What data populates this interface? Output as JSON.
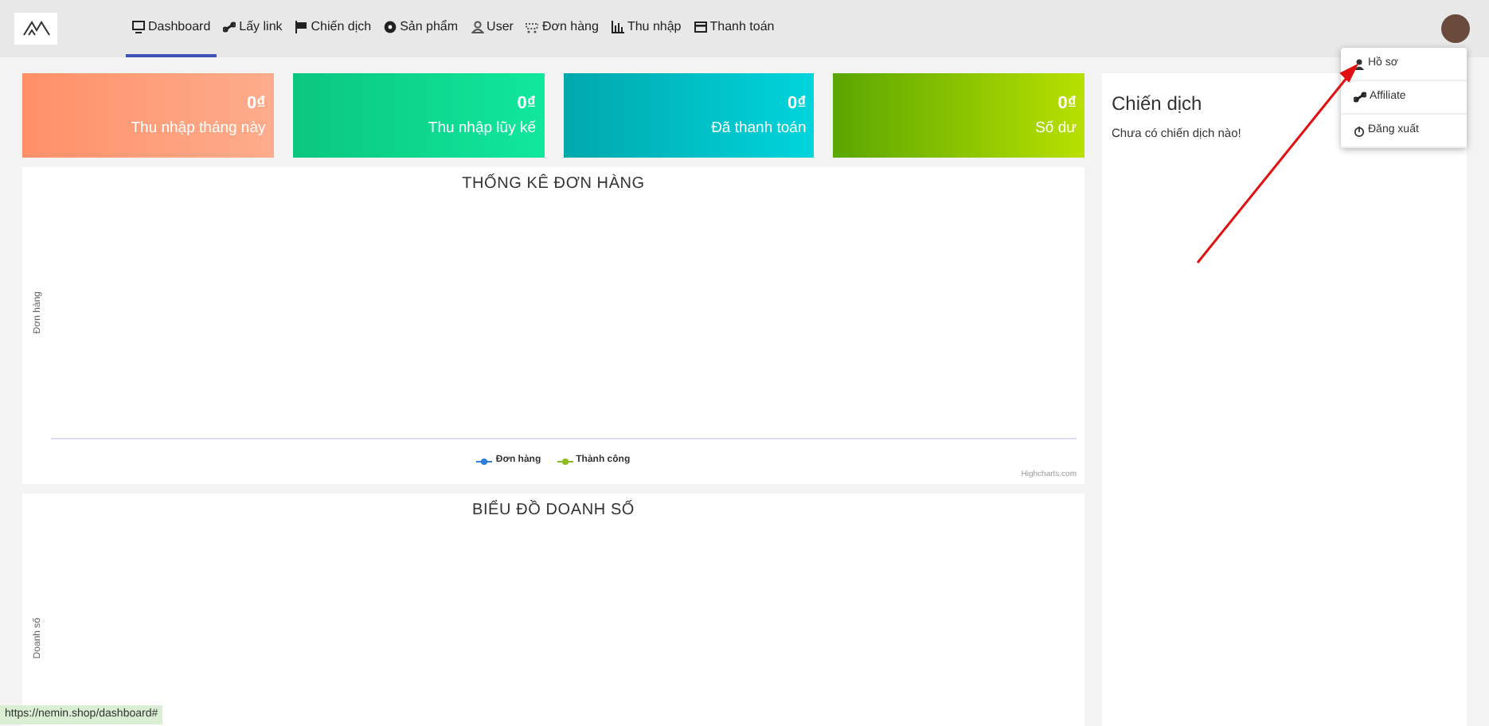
{
  "nav": {
    "items": [
      {
        "label": "Dashboard",
        "selected": true
      },
      {
        "label": "Lấy link",
        "selected": false
      },
      {
        "label": "Chiến dịch",
        "selected": false
      },
      {
        "label": "Sản phẩm",
        "selected": false
      },
      {
        "label": "User",
        "selected": false
      },
      {
        "label": "Đơn hàng",
        "selected": false
      },
      {
        "label": "Thu nhập",
        "selected": false
      },
      {
        "label": "Thanh toán",
        "selected": false
      }
    ]
  },
  "user_menu": {
    "expanded": true,
    "items": [
      "Hồ sơ",
      "Affiliate",
      "Đăng xuất"
    ]
  },
  "stats": [
    {
      "value": "0₫",
      "label": "Thu nhập tháng này"
    },
    {
      "value": "0₫",
      "label": "Thu nhập lũy kế"
    },
    {
      "value": "0₫",
      "label": "Đã thanh toán"
    },
    {
      "value": "0₫",
      "label": "Số dư"
    }
  ],
  "orders_chart": {
    "title": "THỐNG KÊ ĐƠN HÀNG",
    "ylabel": "Đơn hàng",
    "legend": [
      {
        "name": "Đơn hàng",
        "color": "#2f7ed8"
      },
      {
        "name": "Thành công",
        "color": "#8bbc21"
      }
    ],
    "credits": "Highcharts.com"
  },
  "sales_chart": {
    "title": "BIỂU ĐỒ DOANH SỐ",
    "ylabel": "Doanh số"
  },
  "campaign_panel": {
    "title": "Chiến dịch",
    "message": "Chưa có chiến dịch nào!"
  },
  "status_bar": {
    "url": "https://nemin.shop/dashboard#"
  }
}
